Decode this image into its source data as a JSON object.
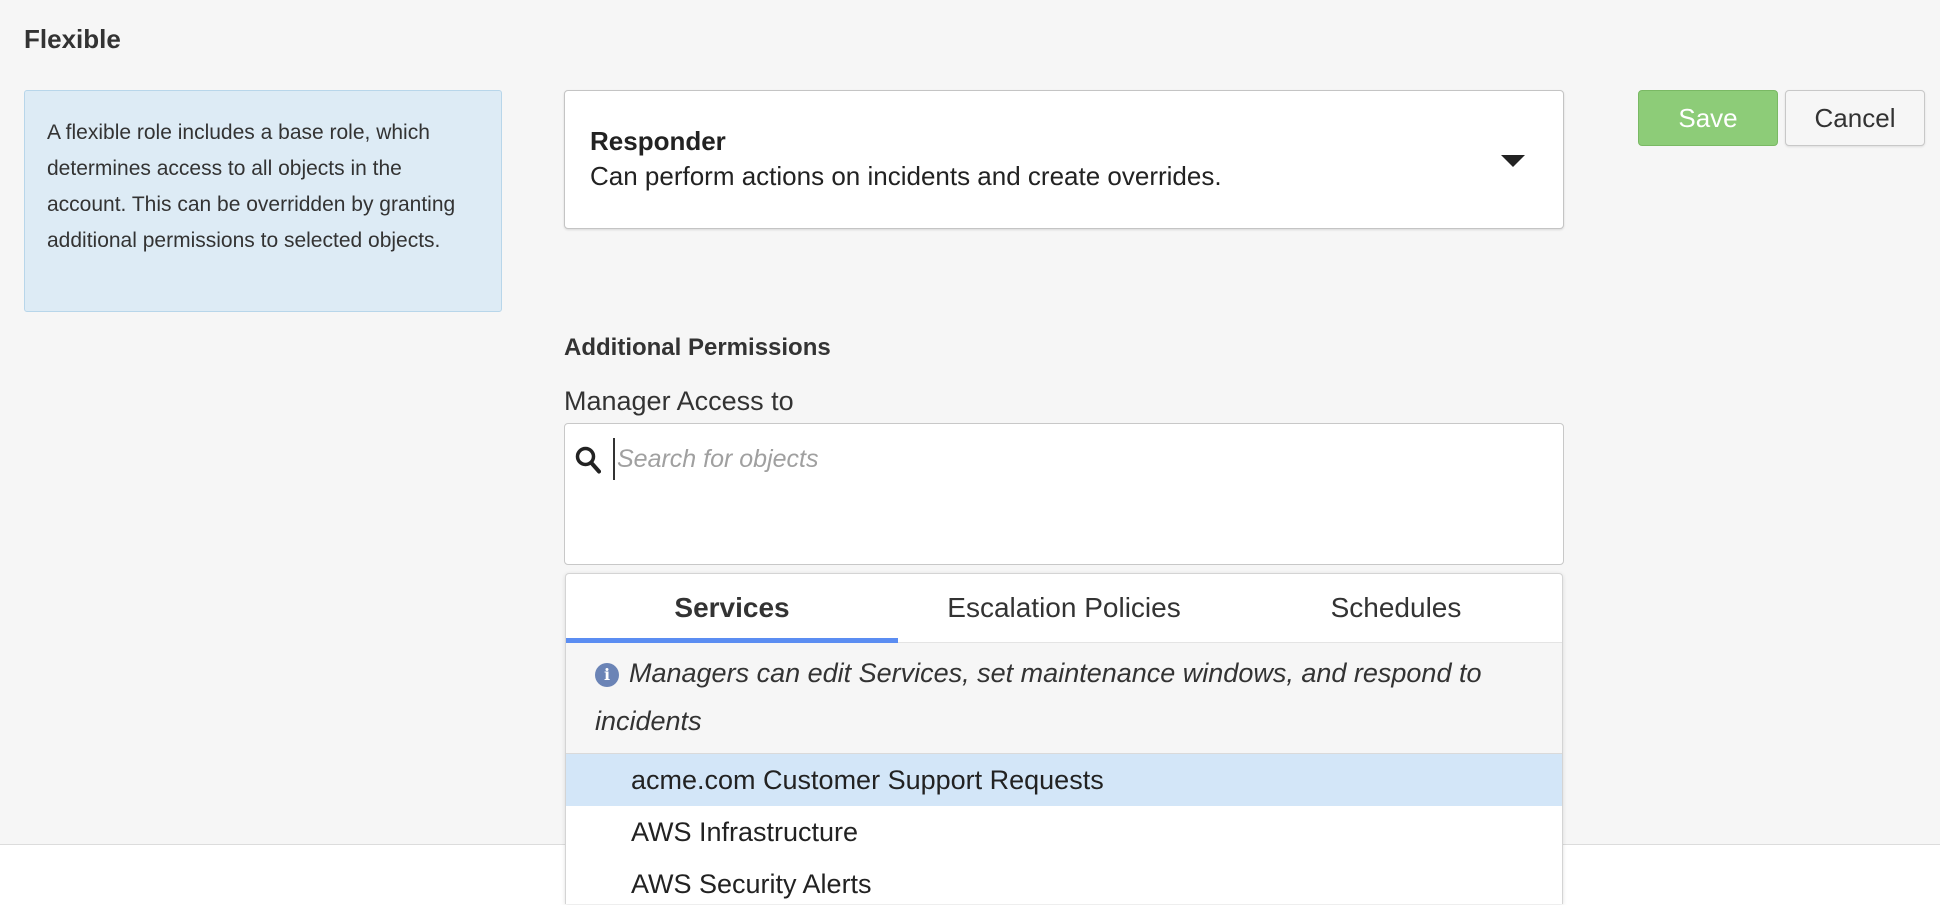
{
  "section": {
    "title": "Flexible"
  },
  "info": {
    "text": "A flexible role includes a base role, which determines access to all objects in the account. This can be overridden by granting additional permissions to selected objects."
  },
  "role_select": {
    "name": "Responder",
    "description": "Can perform actions on incidents and create overrides."
  },
  "actions": {
    "save_label": "Save",
    "cancel_label": "Cancel"
  },
  "permissions": {
    "heading": "Additional Permissions",
    "access_label": "Manager Access to",
    "search_placeholder": "Search for objects"
  },
  "dropdown": {
    "tabs": [
      "Services",
      "Escalation Policies",
      "Schedules"
    ],
    "active_tab": "Services",
    "hint": "Managers can edit Services, set maintenance windows, and respond to incidents",
    "options": [
      "acme.com Customer Support Requests",
      "AWS Infrastructure",
      "AWS Security Alerts"
    ]
  },
  "colors": {
    "save": "#8dcc78",
    "tab_underline": "#5b8df2",
    "highlight": "#d3e6f8",
    "info_box": "#ddebf5"
  }
}
